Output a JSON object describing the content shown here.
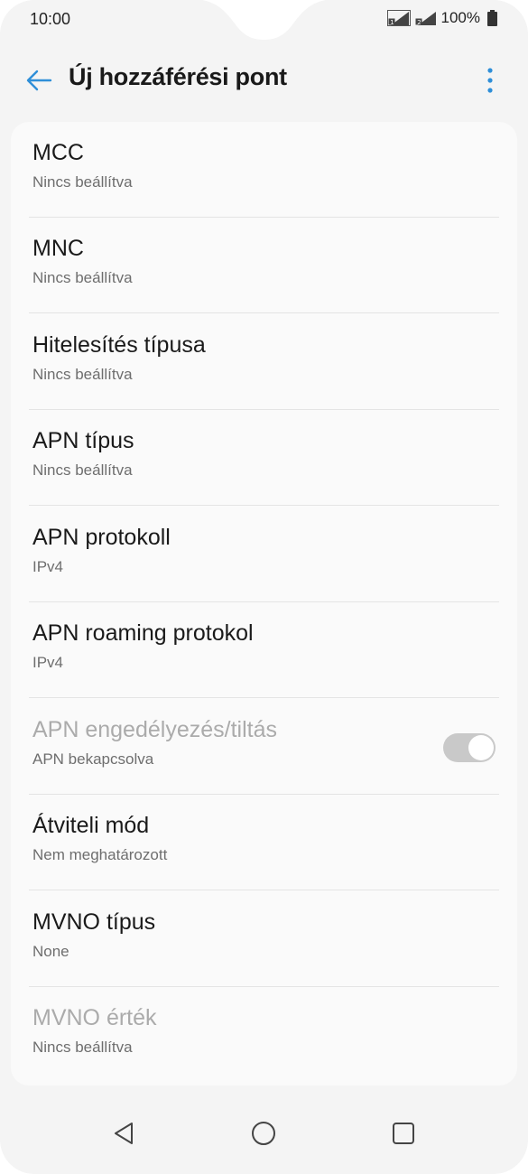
{
  "status_bar": {
    "time": "10:00",
    "battery_text": "100%",
    "sim1_label": "1",
    "sim2_label": "2"
  },
  "header": {
    "title": "Új hozzáférési pont",
    "back_icon": "arrow-left-icon",
    "more_icon": "more-vertical-icon"
  },
  "settings": [
    {
      "title": "MCC",
      "value": "Nincs beállítva",
      "enabled": true
    },
    {
      "title": "MNC",
      "value": "Nincs beállítva",
      "enabled": true
    },
    {
      "title": "Hitelesítés típusa",
      "value": "Nincs beállítva",
      "enabled": true
    },
    {
      "title": "APN típus",
      "value": "Nincs beállítva",
      "enabled": true
    },
    {
      "title": "APN protokoll",
      "value": "IPv4",
      "enabled": true
    },
    {
      "title": "APN roaming protokol",
      "value": "IPv4",
      "enabled": true
    },
    {
      "title": "APN engedélyezés/tiltás",
      "value": "APN bekapcsolva",
      "enabled": false,
      "toggle_on": true
    },
    {
      "title": "Átviteli mód",
      "value": "Nem meghatározott",
      "enabled": true
    },
    {
      "title": "MVNO típus",
      "value": "None",
      "enabled": true
    },
    {
      "title": "MVNO érték",
      "value": "Nincs beállítva",
      "enabled": false
    }
  ],
  "nav_bar": {
    "back_icon": "triangle-back-icon",
    "home_icon": "circle-home-icon",
    "recents_icon": "square-recents-icon"
  },
  "colors": {
    "accent": "#2f8fd8",
    "background": "#f4f4f4",
    "card": "#fafafa",
    "disabled_text": "#ababab"
  }
}
